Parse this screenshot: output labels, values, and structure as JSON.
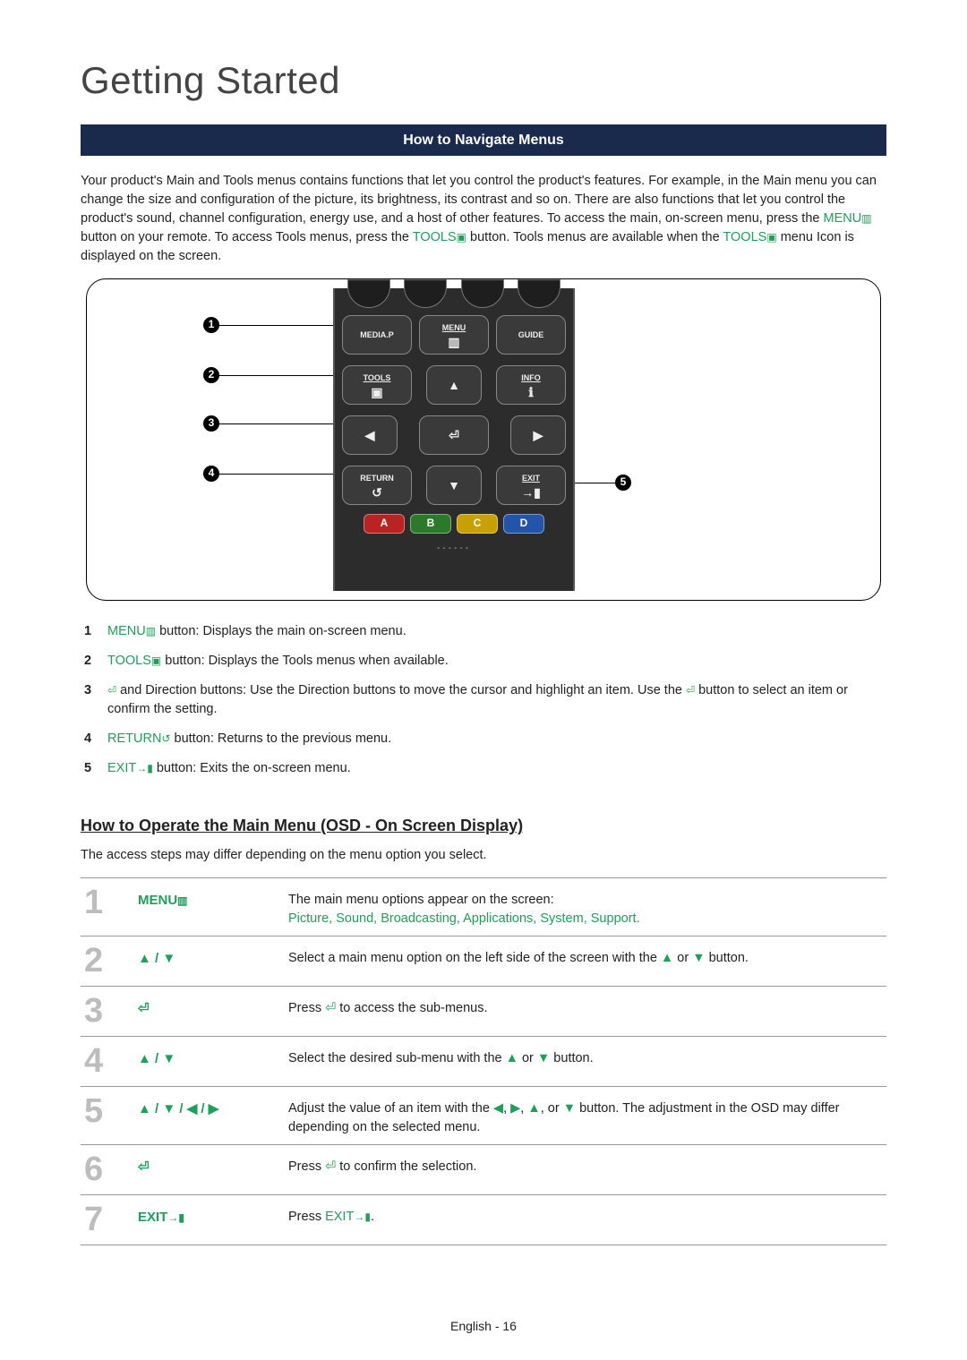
{
  "page_title": "Getting Started",
  "section_bar": "How to Navigate Menus",
  "intro": {
    "a": "Your product's Main and Tools menus contains functions that let you control the product's features. For example, in the Main menu you can change the size and configuration of the picture, its brightness, its contrast and so on. There are also functions that let you control the product's sound, channel configuration, energy use, and a host of other features. To access the main, on-screen menu, press the ",
    "menu_label": "MENU",
    "b": " button on your remote. To access Tools menus, press the ",
    "tools_label": "TOOLS",
    "c": " button. Tools menus are available when the ",
    "tools_label2": "TOOLS",
    "d": " menu Icon is displayed on the screen."
  },
  "remote": {
    "mediap": "MEDIA.P",
    "menu": "MENU",
    "guide": "GUIDE",
    "tools": "TOOLS",
    "info": "INFO",
    "return": "RETURN",
    "exit": "EXIT",
    "a": "A",
    "b": "B",
    "c": "C",
    "d": "D",
    "dashes": "------"
  },
  "callouts": {
    "1": "1",
    "2": "2",
    "3": "3",
    "4": "4",
    "5": "5"
  },
  "legend": {
    "1": {
      "num": "1",
      "label": "MENU",
      "text": " button: Displays the main on-screen menu."
    },
    "2": {
      "num": "2",
      "label": "TOOLS",
      "text": " button: Displays the Tools menus when available."
    },
    "3": {
      "num": "3",
      "pre": "",
      "enter": "⏎",
      "text": " and Direction buttons: Use the Direction buttons to move the cursor and highlight an item. Use the ",
      "enter2": "⏎",
      "text2": " button to select an item or confirm the setting."
    },
    "4": {
      "num": "4",
      "label": "RETURN",
      "text": " button: Returns to the previous menu."
    },
    "5": {
      "num": "5",
      "label": "EXIT",
      "text": " button: Exits the on-screen menu."
    }
  },
  "subheading": "How to Operate the Main Menu (OSD - On Screen Display)",
  "subnote": "The access steps may differ depending on the menu option you select.",
  "steps": {
    "1": {
      "num": "1",
      "key": "MENU",
      "key_icon": "▥",
      "desc_a": "The main menu options appear on the screen:",
      "opts": [
        "Picture",
        "Sound",
        "Broadcasting",
        "Applications",
        "System",
        "Support"
      ]
    },
    "2": {
      "num": "2",
      "key": "▲ / ▼",
      "desc_a": "Select a main menu option on the left side of the screen with the ",
      "desc_b": " or ",
      "desc_c": " button."
    },
    "3": {
      "num": "3",
      "key": "⏎",
      "desc_a": "Press ",
      "desc_b": " to access the sub-menus."
    },
    "4": {
      "num": "4",
      "key": "▲ / ▼",
      "desc_a": "Select the desired sub-menu with the ",
      "desc_b": " or ",
      "desc_c": " button."
    },
    "5": {
      "num": "5",
      "key": "▲ / ▼ / ◀ / ▶",
      "desc_a": "Adjust the value of an item with the ",
      "desc_b": ", ",
      "desc_c": ", ",
      "desc_d": ", or ",
      "desc_e": " button. The adjustment in the OSD may differ depending on the selected menu."
    },
    "6": {
      "num": "6",
      "key": "⏎",
      "desc_a": "Press ",
      "desc_b": " to confirm the selection."
    },
    "7": {
      "num": "7",
      "key": "EXIT",
      "key_icon": "→▮",
      "desc_a": "Press ",
      "desc_label": "EXIT",
      "desc_icon": "→▮",
      "desc_b": "."
    }
  },
  "footer": {
    "lang": "English",
    "sep": " - ",
    "page": "16"
  },
  "sym": {
    "up": "▲",
    "down": "▼",
    "left": "◀",
    "right": "▶",
    "enter": "⏎",
    "return": "↺",
    "exit": "→▮",
    "menu_icon": "▥",
    "tools_icon": "▣",
    "info_icon": "ℹ"
  }
}
